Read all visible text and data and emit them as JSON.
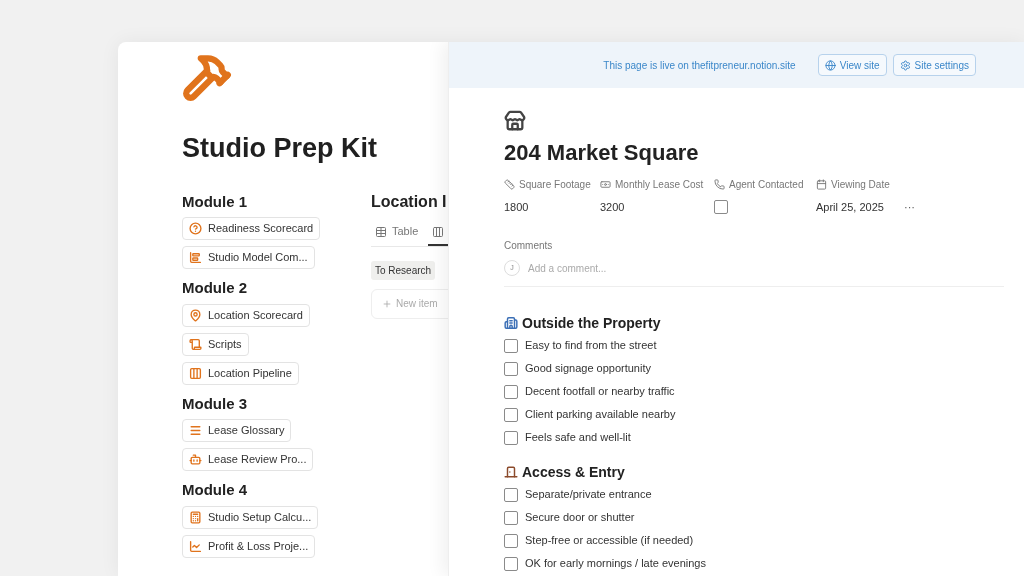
{
  "page": {
    "title": "Studio Prep Kit"
  },
  "modules": [
    {
      "title": "Module 1",
      "links": [
        "Readiness Scorecard",
        "Studio Model Com..."
      ]
    },
    {
      "title": "Module 2",
      "links": [
        "Location Scorecard",
        "Scripts",
        "Location Pipeline"
      ]
    },
    {
      "title": "Module 3",
      "links": [
        "Lease Glossary",
        "Lease Review Pro..."
      ]
    },
    {
      "title": "Module 4",
      "links": [
        "Studio Setup Calcu...",
        "Profit & Loss Proje..."
      ]
    }
  ],
  "database": {
    "title": "Location I",
    "tabs": [
      {
        "kind": "table",
        "label": "Table",
        "selected": false
      },
      {
        "kind": "board",
        "selected": true
      }
    ],
    "group": "To Research",
    "new_item": "New item"
  },
  "banner": {
    "text": "This page is live on thefitpreneur.notion.site",
    "buttons": [
      {
        "kind": "globe",
        "label": "View site"
      },
      {
        "kind": "settings",
        "label": "Site settings"
      }
    ]
  },
  "record": {
    "title": "204 Market Square",
    "properties": [
      {
        "kind": "text",
        "name": "Square Footage",
        "value": "1800"
      },
      {
        "kind": "text",
        "name": "Monthly Lease Cost",
        "value": "3200"
      },
      {
        "kind": "checkbox",
        "name": "Agent Contacted",
        "checked": false
      },
      {
        "kind": "text",
        "name": "Viewing Date",
        "value": "April 25, 2025"
      }
    ],
    "more": "···",
    "comments": {
      "label": "Comments",
      "avatar": "J",
      "placeholder": "Add a comment..."
    },
    "sections": [
      {
        "heading": "Outside the Property",
        "items": [
          {
            "text": "Easy to find from the street",
            "checked": false
          },
          {
            "text": "Good signage opportunity",
            "checked": false
          },
          {
            "text": "Decent footfall or nearby traffic",
            "checked": false
          },
          {
            "text": "Client parking available nearby",
            "checked": false
          },
          {
            "text": "Feels safe and well-lit",
            "checked": false
          }
        ]
      },
      {
        "heading": "Access & Entry",
        "items": [
          {
            "text": "Separate/private entrance",
            "checked": false
          },
          {
            "text": "Secure door or shutter",
            "checked": false
          },
          {
            "text": "Step-free or accessible (if needed)",
            "checked": false
          },
          {
            "text": "OK for early mornings / late evenings",
            "checked": false
          }
        ]
      }
    ]
  }
}
